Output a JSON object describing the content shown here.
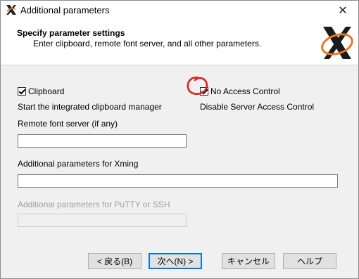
{
  "window": {
    "title": "Additional parameters",
    "close_icon": "close-icon",
    "app_icon": "xming-x-icon"
  },
  "header": {
    "title": "Specify parameter settings",
    "subtitle": "Enter clipboard, remote font server, and all other parameters."
  },
  "options": {
    "clipboard": {
      "label": "Clipboard",
      "checked": true,
      "description": "Start the integrated clipboard manager"
    },
    "no_access_control": {
      "label": "No Access Control",
      "checked": true,
      "description": "Disable Server Access Control"
    }
  },
  "fields": {
    "remote_font_server": {
      "label": "Remote font server (if any)",
      "value": ""
    },
    "xming_params": {
      "label": "Additional parameters for Xming",
      "value": ""
    },
    "putty_params": {
      "label": "Additional parameters for PuTTY or SSH",
      "value": "",
      "disabled": true
    }
  },
  "buttons": {
    "back": "< 戻る(B)",
    "next": "次へ(N) >",
    "cancel": "キャンセル",
    "help": "ヘルプ"
  },
  "colors": {
    "annotation_circle": "#e0201b",
    "logo_orange": "#e87722",
    "default_button_border": "#0078d7"
  }
}
